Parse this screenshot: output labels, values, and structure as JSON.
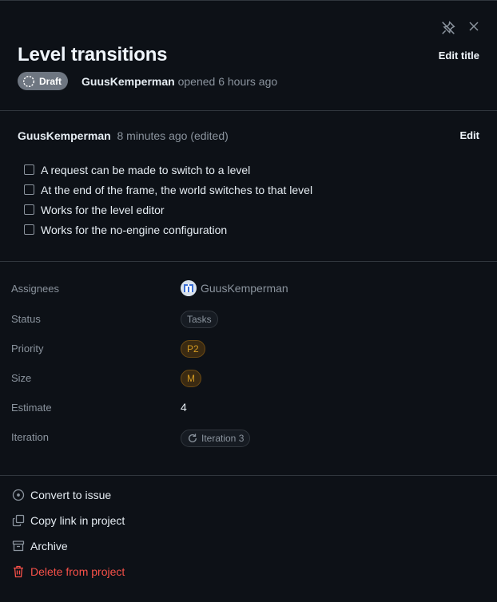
{
  "header": {
    "title": "Level transitions",
    "edit_title_label": "Edit title",
    "status_badge": "Draft",
    "author": "GuusKemperman",
    "opened_text": "opened 6 hours ago"
  },
  "comment": {
    "author": "GuusKemperman",
    "meta": "8 minutes ago (edited)",
    "edit_label": "Edit",
    "tasks": [
      {
        "label": "A request can be made to switch to a level",
        "checked": false
      },
      {
        "label": "At the end of the frame, the world switches to that level",
        "checked": false
      },
      {
        "label": "Works for the level editor",
        "checked": false
      },
      {
        "label": "Works for the no-engine configuration",
        "checked": false
      }
    ]
  },
  "fields": {
    "assignees": {
      "label": "Assignees",
      "value": "GuusKemperman"
    },
    "status": {
      "label": "Status",
      "value": "Tasks"
    },
    "priority": {
      "label": "Priority",
      "value": "P2"
    },
    "size": {
      "label": "Size",
      "value": "M"
    },
    "estimate": {
      "label": "Estimate",
      "value": "4"
    },
    "iteration": {
      "label": "Iteration",
      "value": "Iteration 3"
    }
  },
  "actions": {
    "convert": "Convert to issue",
    "copy_link": "Copy link in project",
    "archive": "Archive",
    "delete": "Delete from project"
  },
  "colors": {
    "background": "#0d1117",
    "danger": "#f85149",
    "warning": "#d29922",
    "muted": "#8b949e"
  }
}
